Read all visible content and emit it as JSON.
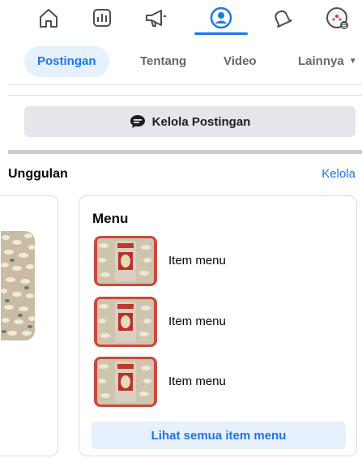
{
  "nav": {
    "icons": [
      "home-icon",
      "dashboard-icon",
      "megaphone-icon",
      "profile-icon",
      "bell-icon",
      "menu-avatar-icon"
    ],
    "active": "profile-icon",
    "accent": "#1877f2"
  },
  "tabs": [
    {
      "label": "Postingan",
      "active": true
    },
    {
      "label": "Tentang",
      "active": false
    },
    {
      "label": "Video",
      "active": false
    },
    {
      "label": "Lainnya",
      "active": false
    }
  ],
  "manage_posts": {
    "label": "Kelola Postingan",
    "icon": "chat-bubble-icon"
  },
  "featured": {
    "title": "Unggulan",
    "manage_label": "Kelola",
    "menu_card": {
      "title": "Menu",
      "items": [
        {
          "name": "Item menu"
        },
        {
          "name": "Item menu"
        },
        {
          "name": "Item menu"
        }
      ],
      "see_all_label": "Lihat semua item menu"
    }
  }
}
